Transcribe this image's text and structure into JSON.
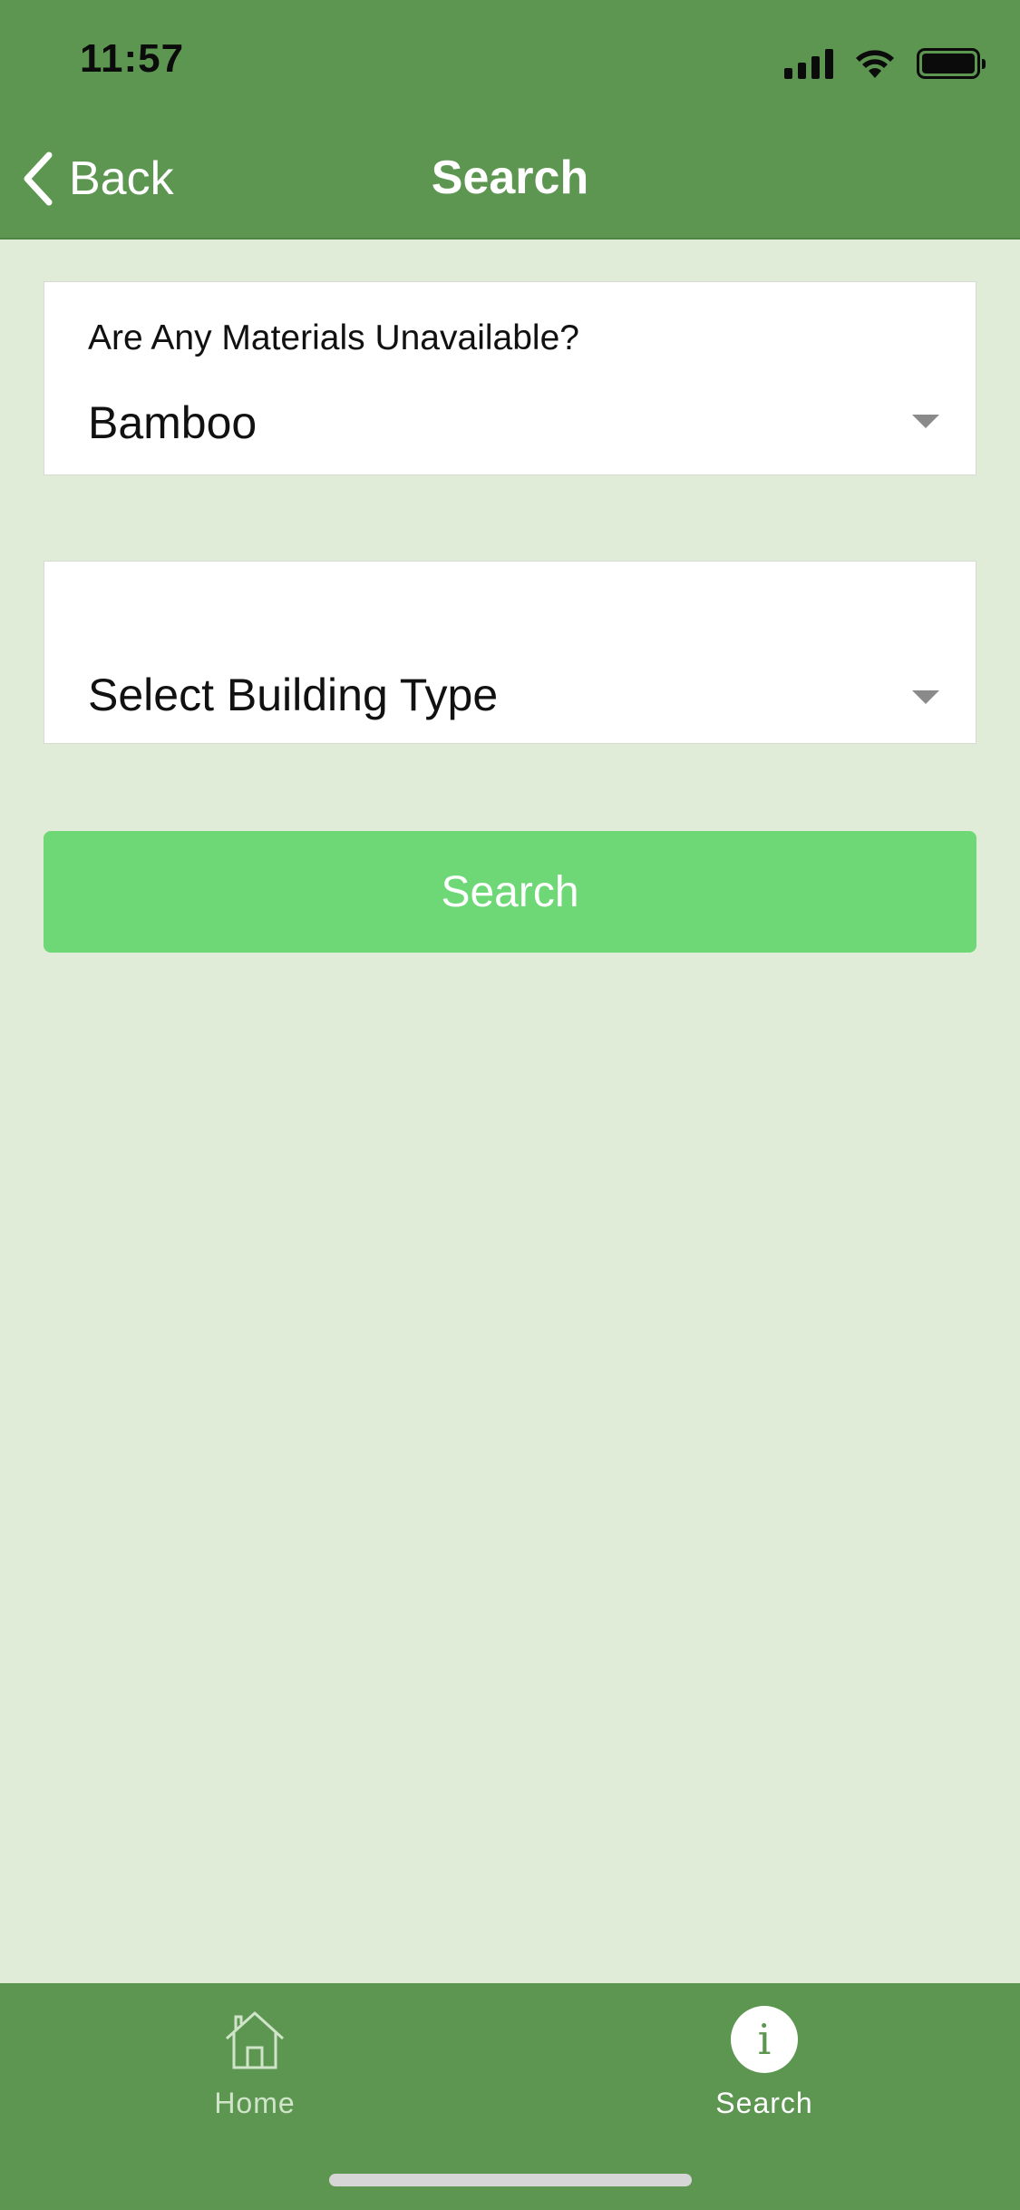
{
  "status_bar": {
    "time": "11:57",
    "icons": [
      "signal-icon",
      "wifi-icon",
      "battery-icon"
    ]
  },
  "nav": {
    "back_label": "Back",
    "back_icon": "chevron-left-icon",
    "title": "Search"
  },
  "materials_field": {
    "label": "Are Any Materials Unavailable?",
    "value": "Bamboo",
    "icon": "chevron-down-icon"
  },
  "building_field": {
    "label": "",
    "value": "Select Building Type",
    "icon": "chevron-down-icon"
  },
  "search_button": {
    "label": "Search"
  },
  "tab_bar": {
    "items": [
      {
        "label": "Home",
        "icon": "home-icon",
        "active": false
      },
      {
        "label": "Search",
        "icon": "info-icon",
        "icon_glyph": "i",
        "active": true
      }
    ]
  },
  "colors": {
    "header": "#5d9651",
    "background": "#e0ecd7",
    "button": "#6dd875",
    "card": "#ffffff"
  }
}
